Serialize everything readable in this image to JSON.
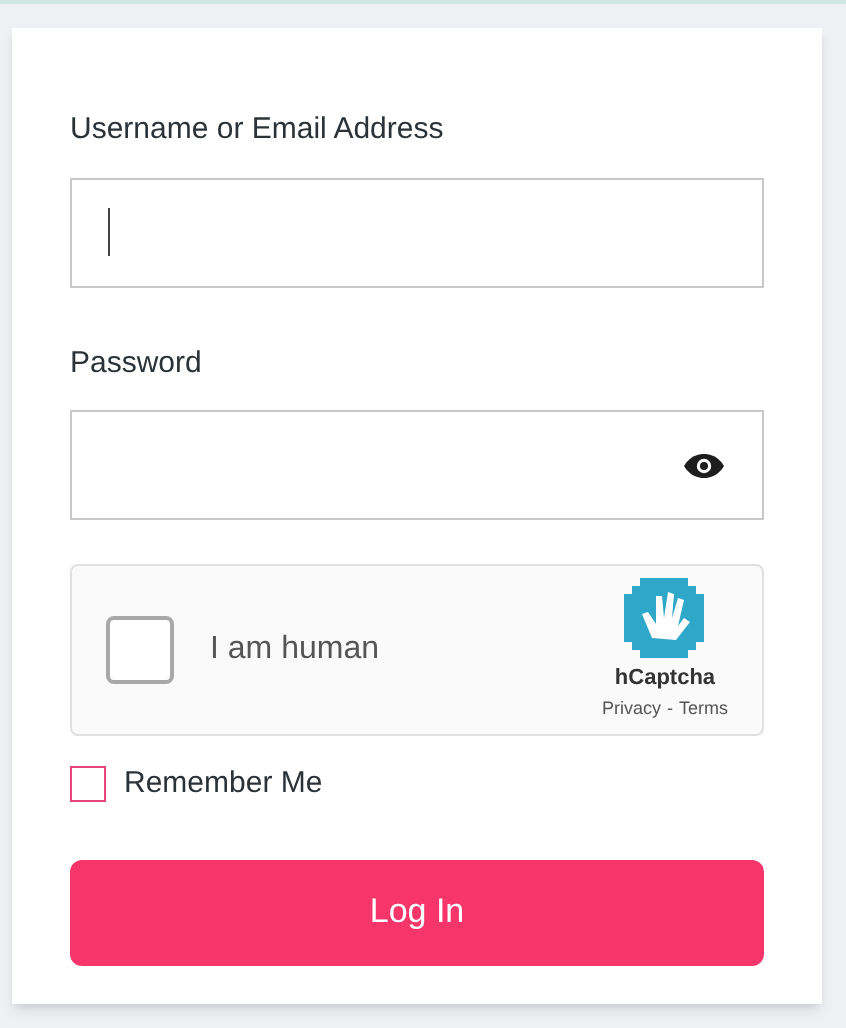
{
  "fields": [
    {
      "label": "Username or Email Address",
      "kind": "text",
      "focused": true
    },
    {
      "label": "Password",
      "kind": "password",
      "focused": false
    }
  ],
  "captcha": {
    "label": "I am human",
    "checked": false,
    "brand": "hCaptcha",
    "links": [
      "Privacy",
      "Terms"
    ],
    "separator": "-"
  },
  "remember": {
    "label": "Remember Me",
    "checked": false
  },
  "button": "Log In"
}
